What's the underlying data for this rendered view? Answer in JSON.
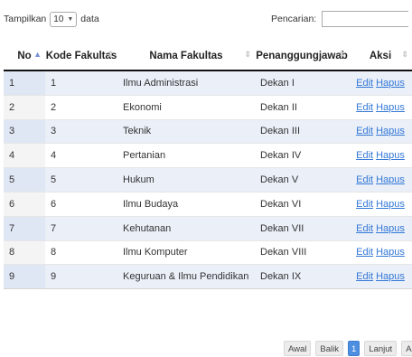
{
  "controls": {
    "show_label": "Tampilkan",
    "page_length": "10",
    "data_label": "data",
    "search_label": "Pencarian:",
    "search_value": ""
  },
  "table": {
    "columns": [
      "No",
      "Kode Fakultas",
      "Nama Fakultas",
      "Penanggungjawab",
      "Aksi"
    ],
    "rows": [
      {
        "no": "1",
        "kode": "1",
        "nama": "Ilmu Administrasi",
        "pj": "Dekan I"
      },
      {
        "no": "2",
        "kode": "2",
        "nama": "Ekonomi",
        "pj": "Dekan II"
      },
      {
        "no": "3",
        "kode": "3",
        "nama": "Teknik",
        "pj": "Dekan III"
      },
      {
        "no": "4",
        "kode": "4",
        "nama": "Pertanian",
        "pj": "Dekan IV"
      },
      {
        "no": "5",
        "kode": "5",
        "nama": "Hukum",
        "pj": "Dekan V"
      },
      {
        "no": "6",
        "kode": "6",
        "nama": "Ilmu Budaya",
        "pj": "Dekan VI"
      },
      {
        "no": "7",
        "kode": "7",
        "nama": "Kehutanan",
        "pj": "Dekan VII"
      },
      {
        "no": "8",
        "kode": "8",
        "nama": "Ilmu Komputer",
        "pj": "Dekan VIII"
      },
      {
        "no": "9",
        "kode": "9",
        "nama": "Keguruan & Ilmu Pendidikan",
        "pj": "Dekan IX"
      }
    ],
    "edit_label": "Edit",
    "delete_label": "Hapus"
  },
  "pagination": {
    "first": "Awal",
    "prev": "Balik",
    "current": "1",
    "next": "Lanjut",
    "last": "Akhir"
  },
  "colors": {
    "odd_row": "#eaeff8",
    "link": "#3478d6",
    "current_page": "#4d8ee0"
  }
}
